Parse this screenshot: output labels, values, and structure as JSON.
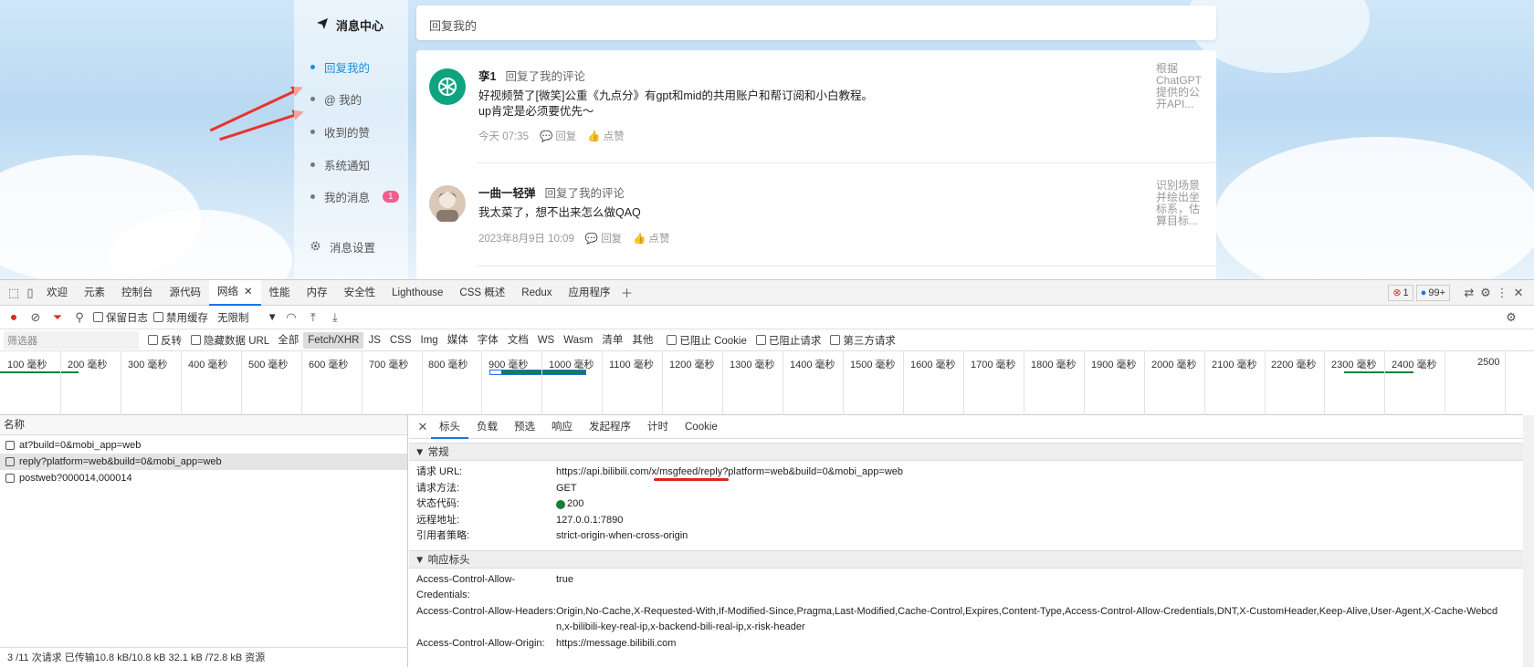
{
  "sidebar": {
    "title": "消息中心",
    "items": [
      {
        "label": "回复我的",
        "active": true
      },
      {
        "label": "@ 我的"
      },
      {
        "label": "收到的赞"
      },
      {
        "label": "系统通知"
      },
      {
        "label": "我的消息",
        "badge": "1"
      }
    ],
    "settings": "消息设置"
  },
  "panel": {
    "title": "回复我的",
    "messages": [
      {
        "name": "孪1",
        "action": "回复了我的评论",
        "line1": "好视频赞了[微笑]公重《九点分》有gpt和mid的共用账户和帮订阅和小白教程。",
        "line2": "up肯定是必须要优先～",
        "time": "今天 07:35",
        "reply": "回复",
        "like": "点赞",
        "ref": "根据ChatGPT提供的公开API..."
      },
      {
        "name": "一曲一轻弹",
        "action": "回复了我的评论",
        "line1": "我太菜了，想不出来怎么做QAQ",
        "time": "2023年8月9日 10:09",
        "reply": "回复",
        "like": "点赞",
        "ref": "识别场景并绘出坐标系，估算目标..."
      }
    ]
  },
  "devtools": {
    "tabs": [
      "欢迎",
      "元素",
      "控制台",
      "源代码",
      "网络",
      "性能",
      "内存",
      "安全性",
      "Lighthouse",
      "CSS 概述",
      "Redux",
      "应用程序"
    ],
    "active_tab": "网络",
    "errors": "1",
    "issues": "99+",
    "toolbar": {
      "preserve_log": "保留日志",
      "disable_cache": "禁用缓存",
      "throttle": "无限制"
    },
    "filter": {
      "placeholder": "筛选器",
      "invert": "反转",
      "hide_data_url": "隐藏数据 URL",
      "types": [
        "全部",
        "Fetch/XHR",
        "JS",
        "CSS",
        "Img",
        "媒体",
        "字体",
        "文档",
        "WS",
        "Wasm",
        "清单",
        "其他"
      ],
      "active_type": "Fetch/XHR",
      "blocked_cookies": "已阻止 Cookie",
      "blocked_requests": "已阻止请求",
      "third_party": "第三方请求"
    },
    "timeline_ticks": [
      "100 毫秒",
      "200 毫秒",
      "300 毫秒",
      "400 毫秒",
      "500 毫秒",
      "600 毫秒",
      "700 毫秒",
      "800 毫秒",
      "900 毫秒",
      "1000 毫秒",
      "1100 毫秒",
      "1200 毫秒",
      "1300 毫秒",
      "1400 毫秒",
      "1500 毫秒",
      "1600 毫秒",
      "1700 毫秒",
      "1800 毫秒",
      "1900 毫秒",
      "2000 毫秒",
      "2100 毫秒",
      "2200 毫秒",
      "2300 毫秒",
      "2400 毫秒",
      "2500"
    ],
    "requests": {
      "header": "名称",
      "rows": [
        "at?build=0&mobi_app=web",
        "reply?platform=web&build=0&mobi_app=web",
        "postweb?000014,000014"
      ],
      "selected": 1,
      "status": "3 /11 次请求  已传输10.8 kB/10.8 kB  32.1 kB /72.8 kB 资源"
    },
    "detail": {
      "tabs": [
        "标头",
        "负载",
        "预选",
        "响应",
        "发起程序",
        "计时",
        "Cookie"
      ],
      "active_tab": "标头",
      "general_title": "▼ 常规",
      "general": [
        {
          "k": "请求 URL:",
          "v": "https://api.bilibili.com/x/msgfeed/reply?platform=web&build=0&mobi_app=web"
        },
        {
          "k": "请求方法:",
          "v": "GET"
        },
        {
          "k": "状态代码:",
          "v": "200"
        },
        {
          "k": "远程地址:",
          "v": "127.0.0.1:7890"
        },
        {
          "k": "引用者策略:",
          "v": "strict-origin-when-cross-origin"
        }
      ],
      "response_title": "▼ 响应标头",
      "response": [
        {
          "k": "Access-Control-Allow-Credentials:",
          "v": "true"
        },
        {
          "k": "Access-Control-Allow-Headers:",
          "v": "Origin,No-Cache,X-Requested-With,If-Modified-Since,Pragma,Last-Modified,Cache-Control,Expires,Content-Type,Access-Control-Allow-Credentials,DNT,X-CustomHeader,Keep-Alive,User-Agent,X-Cache-Webcdn,x-bilibili-key-real-ip,x-backend-bili-real-ip,x-risk-header"
        },
        {
          "k": "Access-Control-Allow-Origin:",
          "v": "https://message.bilibili.com"
        }
      ]
    },
    "colors": {
      "accent": "#1a73e8",
      "status_ok": "#188038",
      "error": "#d93025"
    }
  }
}
